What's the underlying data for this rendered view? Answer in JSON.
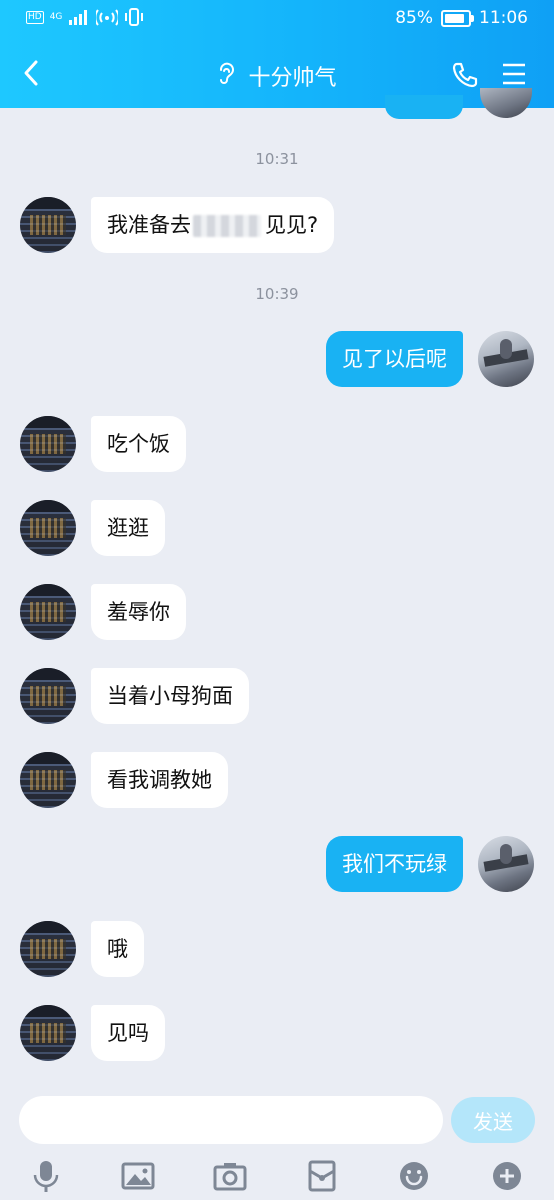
{
  "status_bar": {
    "left_labels": [
      "HD",
      "4G"
    ],
    "battery_percent": "85%",
    "battery_level": 0.85,
    "time": "11:06"
  },
  "header": {
    "title": "十分帅气"
  },
  "messages": [
    {
      "type": "time",
      "text": "10:31"
    },
    {
      "type": "msg",
      "side": "left",
      "text_before": "我准备去",
      "text_after": "见见?"
    },
    {
      "type": "time",
      "text": "10:39"
    },
    {
      "type": "msg",
      "side": "right",
      "text": "见了以后呢"
    },
    {
      "type": "msg",
      "side": "left",
      "text": "吃个饭"
    },
    {
      "type": "msg",
      "side": "left",
      "text": "逛逛"
    },
    {
      "type": "msg",
      "side": "left",
      "text": "羞辱你"
    },
    {
      "type": "msg",
      "side": "left",
      "text": "当着小母狗面"
    },
    {
      "type": "msg",
      "side": "left",
      "text": "看我调教她"
    },
    {
      "type": "msg",
      "side": "right",
      "text": "我们不玩绿"
    },
    {
      "type": "msg",
      "side": "left",
      "text": "哦"
    },
    {
      "type": "msg",
      "side": "left",
      "text": "见吗"
    }
  ],
  "input": {
    "value": "",
    "send_label": "发送"
  },
  "toolbar": {
    "icons": [
      "microphone-icon",
      "image-icon",
      "camera-icon",
      "red-packet-icon",
      "emoji-icon",
      "plus-icon"
    ]
  },
  "colors": {
    "header_start": "#1ec8ff",
    "header_end": "#0fa0f5",
    "bubble_self": "#19b2f3",
    "bubble_other": "#ffffff",
    "background": "#eaedf4",
    "send_disabled": "#b4e6fa",
    "toolbar_icon": "#7e8795"
  }
}
